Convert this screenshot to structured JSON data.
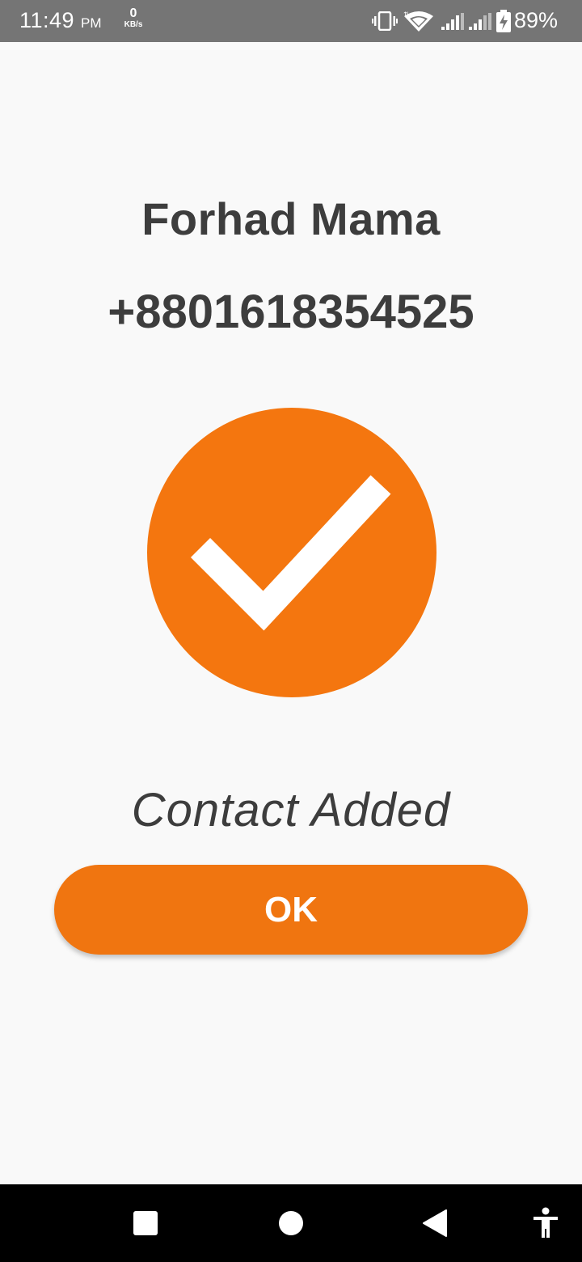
{
  "status_bar": {
    "time": "11:49",
    "ampm": "PM",
    "net_speed_value": "0",
    "net_speed_unit": "KB/s",
    "battery_percent": "89%",
    "icons": [
      "vibrate-icon",
      "wifi-icon",
      "signal-icon",
      "signal-icon",
      "battery-charging-icon"
    ]
  },
  "contact": {
    "name": "Forhad Mama",
    "phone": "+8801618354525"
  },
  "status_icon": "check-circle-icon",
  "status_message": "Contact Added",
  "ok_button_label": "OK",
  "colors": {
    "accent": "#F4760F",
    "text": "#3D3D3D",
    "background": "#F9F9F9",
    "status_bar": "#757575"
  },
  "nav_bar": {
    "buttons": [
      "recents-icon",
      "home-icon",
      "back-icon",
      "accessibility-icon"
    ]
  }
}
